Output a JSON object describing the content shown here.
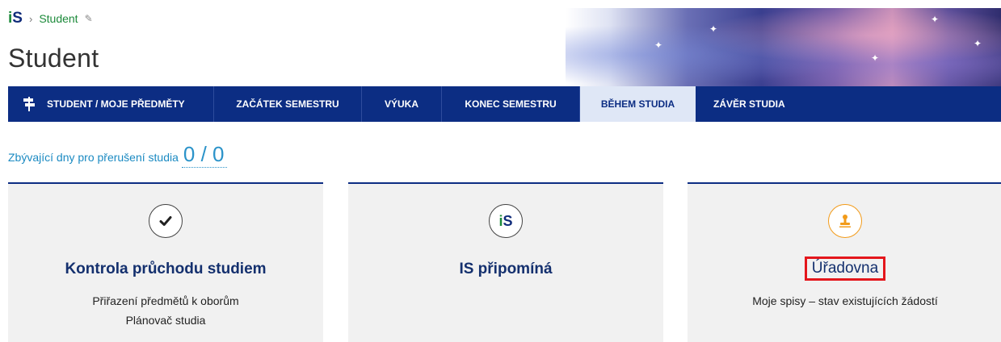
{
  "breadcrumb": {
    "logo_i": "i",
    "logo_s": "S",
    "separator": "›",
    "current": "Student",
    "pin_icon": "pin-icon"
  },
  "page": {
    "title": "Student"
  },
  "nav": {
    "items": [
      {
        "label": "STUDENT / MOJE PŘEDMĚTY",
        "icon": "signpost-icon"
      },
      {
        "label": "ZAČÁTEK SEMESTRU"
      },
      {
        "label": "VÝUKA"
      },
      {
        "label": "KONEC SEMESTRU"
      },
      {
        "label": "BĚHEM STUDIA",
        "active": true
      },
      {
        "label": "ZÁVĚR STUDIA"
      }
    ]
  },
  "interruption": {
    "label": "Zbývající dny pro přerušení studia",
    "value": "0 / 0"
  },
  "cards": [
    {
      "icon": "checkmark-icon",
      "title": "Kontrola průchodu studiem",
      "links": [
        "Přiřazení předmětů k oborům",
        "Plánovač studia"
      ]
    },
    {
      "icon": "is-logo-icon",
      "icon_i": "i",
      "icon_s": "S",
      "title": "IS připomíná",
      "links": []
    },
    {
      "icon": "stamp-icon",
      "title": "Úřadovna",
      "links": [
        "Moje spisy – stav existujících žádostí"
      ]
    }
  ],
  "colors": {
    "nav_bg": "#0c2d83",
    "nav_active_bg": "#dfe7f6",
    "accent_green": "#1c8a3a",
    "accent_blue": "#1b8ac2",
    "highlight_red": "#e4161c",
    "stamp_orange": "#f29b1a"
  }
}
